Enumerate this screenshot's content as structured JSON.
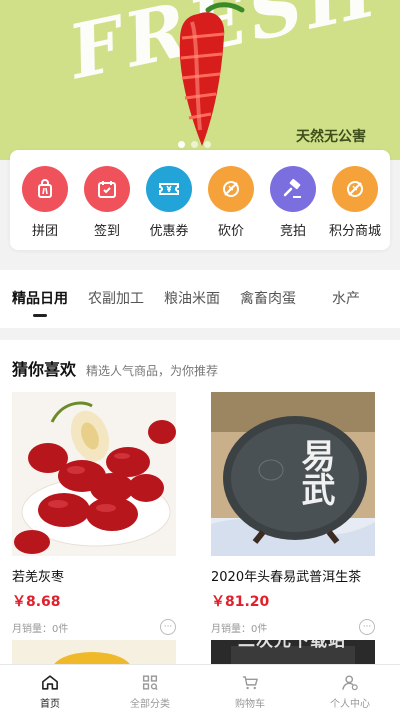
{
  "banner": {
    "word": "FRESH",
    "tagline": "天然无公害",
    "slides": 3,
    "active_slide": 0
  },
  "quick_menu": [
    {
      "label": "拼团",
      "icon": "group-buy-icon",
      "color": "#f0525b"
    },
    {
      "label": "签到",
      "icon": "calendar-checkin-icon",
      "color": "#f0525b"
    },
    {
      "label": "优惠券",
      "icon": "coupon-icon",
      "color": "#23a4d8"
    },
    {
      "label": "砍价",
      "icon": "bargain-icon",
      "color": "#f5a23a"
    },
    {
      "label": "竞拍",
      "icon": "auction-hammer-icon",
      "color": "#7b6fe0"
    },
    {
      "label": "积分商城",
      "icon": "points-mall-icon",
      "color": "#f5a23a"
    }
  ],
  "tabs": [
    "精品日用",
    "农副加工",
    "粮油米面",
    "禽畜肉蛋",
    "水产"
  ],
  "active_tab": "精品日用",
  "recommend": {
    "title": "猜你喜欢",
    "subtitle": "精选人气商品，为你推荐",
    "products": [
      {
        "name": "若羌灰枣",
        "price": "￥8.68",
        "sales": "月销量：0件",
        "more": "···"
      },
      {
        "name": "2020年头春易武普洱生茶",
        "price": "￥81.20",
        "sales": "月销量：0件",
        "more": "···"
      }
    ],
    "cake_text": "易武",
    "watermark": "二次元下载站"
  },
  "nav": [
    {
      "label": "首页",
      "icon": "home-icon",
      "active": true
    },
    {
      "label": "全部分类",
      "icon": "category-grid-icon",
      "active": false
    },
    {
      "label": "购物车",
      "icon": "cart-icon",
      "active": false
    },
    {
      "label": "个人中心",
      "icon": "user-center-icon",
      "active": false
    }
  ],
  "colors": {
    "price": "#e0202b",
    "banner_bg": "#cfe089",
    "active_text": "#222222",
    "inactive_text": "#999999"
  }
}
